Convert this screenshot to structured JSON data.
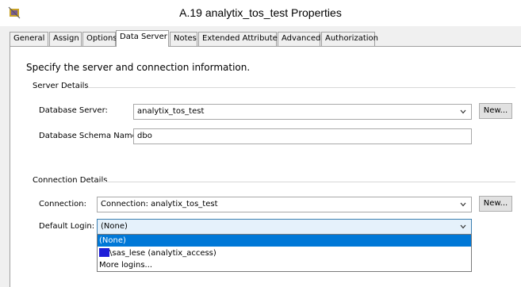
{
  "window": {
    "title": "A.19 analytix_tos_test Properties"
  },
  "tabs": [
    {
      "label": "General"
    },
    {
      "label": "Assign"
    },
    {
      "label": "Options"
    },
    {
      "label": "Data Server",
      "active": true
    },
    {
      "label": "Notes"
    },
    {
      "label": "Extended Attributes"
    },
    {
      "label": "Advanced"
    },
    {
      "label": "Authorization"
    }
  ],
  "panel": {
    "intro": "Specify the server and connection information.",
    "server_details": {
      "heading": "Server Details",
      "database_server_label": "Database Server:",
      "database_server_value": "analytix_tos_test",
      "new_button": "New...",
      "schema_label": "Database Schema Name:",
      "schema_value": "dbo"
    },
    "connection_details": {
      "heading": "Connection Details",
      "connection_label": "Connection:",
      "connection_value": "Connection: analytix_tos_test",
      "new_button": "New...",
      "default_login_label": "Default Login:",
      "default_login_value": "(None)"
    }
  },
  "dropdown": {
    "items": [
      {
        "label": "(None)",
        "selected": true
      },
      {
        "label": "\\sas_lese (analytix_access)",
        "redacted_prefix": true
      },
      {
        "label": "More logins..."
      }
    ]
  },
  "colors": {
    "selection": "#0078d7",
    "redaction": "#1e1ed8",
    "focus_bg": "#e5f1fb"
  }
}
